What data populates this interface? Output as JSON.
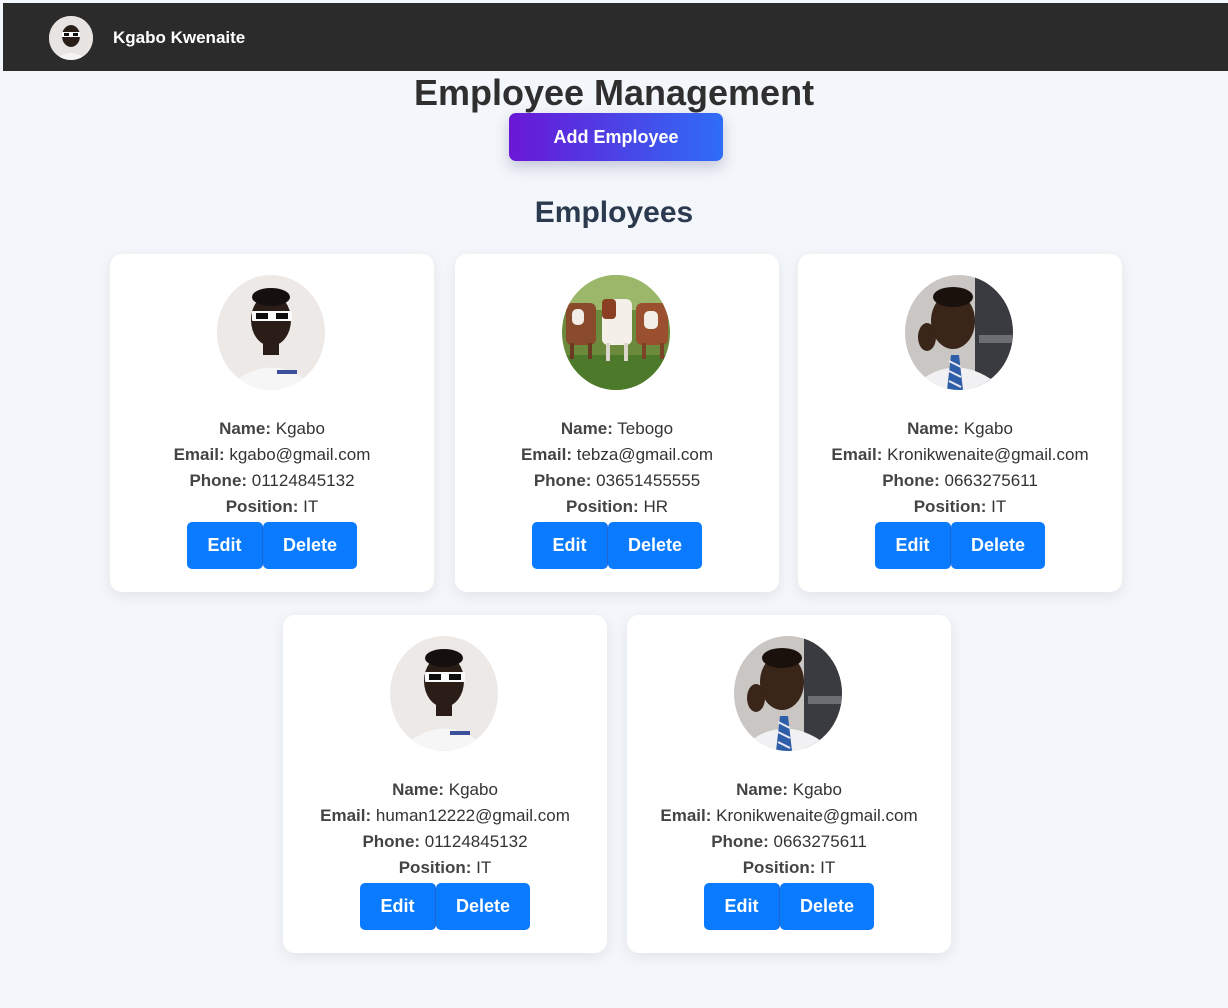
{
  "navbar": {
    "user_name": "Kgabo Kwenaite",
    "avatar_icon": "user-avatar-icon"
  },
  "page": {
    "title": "Employee Management",
    "add_button_label": "Add Employee",
    "section_title": "Employees"
  },
  "colors": {
    "navbar_bg": "#2b2b2b",
    "page_bg": "#f3f6fa",
    "action_blue": "#0a7bff",
    "add_gradient_start": "#6a17d6",
    "add_gradient_end": "#2f6df6"
  },
  "labels": {
    "name": "Name:",
    "email": "Email:",
    "phone": "Phone:",
    "position": "Position:",
    "edit": "Edit",
    "delete": "Delete"
  },
  "employees": [
    {
      "name": "Kgabo",
      "email": "kgabo@gmail.com",
      "phone": "01124845132",
      "position": "IT",
      "photo_icon": "man-sunglasses-photo-icon"
    },
    {
      "name": "Tebogo",
      "email": "tebza@gmail.com",
      "phone": "03651455555",
      "position": "HR",
      "photo_icon": "cows-photo-icon"
    },
    {
      "name": "Kgabo",
      "email": "Kronikwenaite@gmail.com",
      "phone": "0663275611",
      "position": "IT",
      "photo_icon": "man-selfie-photo-icon"
    },
    {
      "name": "Kgabo",
      "email": "human12222@gmail.com",
      "phone": "01124845132",
      "position": "IT",
      "photo_icon": "man-sunglasses-photo-icon"
    },
    {
      "name": "Kgabo",
      "email": "Kronikwenaite@gmail.com",
      "phone": "0663275611",
      "position": "IT",
      "photo_icon": "man-selfie-photo-icon"
    }
  ]
}
